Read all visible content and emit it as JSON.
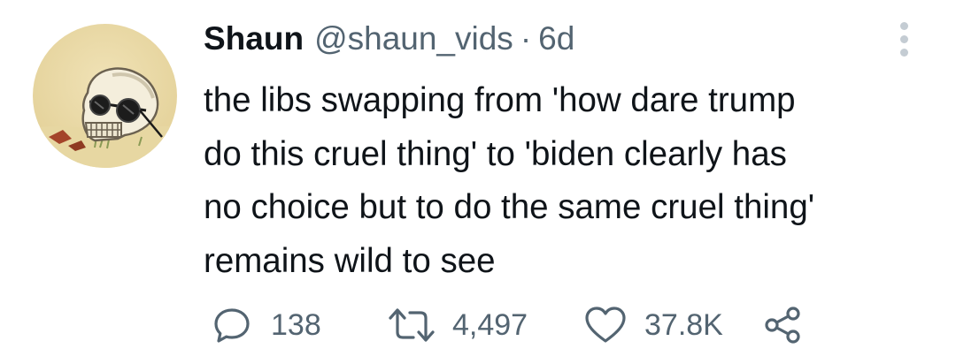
{
  "tweet": {
    "display_name": "Shaun",
    "handle": "@shaun_vids",
    "separator": "·",
    "time": "6d",
    "lines": [
      "the libs swapping from 'how dare trump",
      "do this cruel thing' to 'biden clearly has",
      "no choice but to do the same cruel thing'",
      "remains wild to see"
    ]
  },
  "actions": {
    "replies": "138",
    "retweets": "4,497",
    "likes": "37.8K"
  },
  "icons": {
    "avatar": "skull-with-sunglasses-avatar",
    "more": "more-vertical-icon",
    "reply": "reply-bubble-icon",
    "retweet": "retweet-icon",
    "like": "heart-icon",
    "share": "share-icon"
  },
  "colors": {
    "text_primary": "#0f1419",
    "text_secondary": "#536471",
    "avatar_background": "#e9d9a8"
  }
}
